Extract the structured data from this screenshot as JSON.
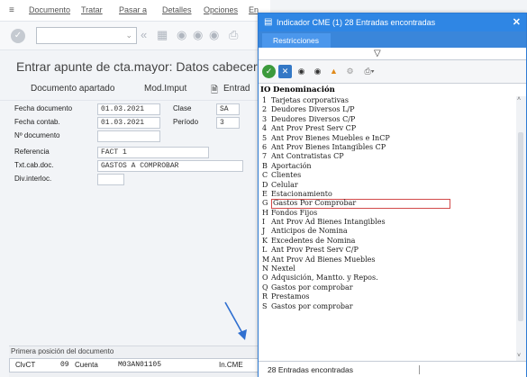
{
  "menu": {
    "items": [
      "Documento",
      "Tratar",
      "Pasar a",
      "Detalles",
      "Opciones",
      "En"
    ]
  },
  "window": {
    "title": "Entrar apunte de cta.mayor: Datos cabecera",
    "app_toolbar": [
      "Documento apartado",
      "Mod.Imput",
      "Entrad"
    ]
  },
  "form": {
    "fecha_documento_label": "Fecha documento",
    "fecha_documento": "01.03.2021",
    "clase_label": "Clase",
    "clase": "SA",
    "fecha_contab_label": "Fecha contab.",
    "fecha_contab": "01.03.2021",
    "periodo_label": "Período",
    "periodo": "3",
    "n_documento_label": "Nº documento",
    "referencia_label": "Referencia",
    "referencia": "FACT 1",
    "txt_cab_label": "Txt.cab.doc.",
    "txt_cab": "GASTOS A COMPROBAR",
    "div_interloc_label": "Div.interloc."
  },
  "bottom": {
    "title": "Primera posición del documento",
    "clvct_label": "ClvCT",
    "clvct": "09",
    "cuenta_label": "Cuenta",
    "cuenta": "M03AN01105",
    "incme_label": "In.CME"
  },
  "popup": {
    "title": "Indicador CME (1)   28 Entradas encontradas",
    "tab": "Restricciones",
    "header_io": "IO",
    "header_den": "Denominación",
    "status": "28 Entradas encontradas",
    "entries": [
      {
        "io": "1",
        "den": "Tarjetas corporativas"
      },
      {
        "io": "2",
        "den": "Deudores Diversos L/P"
      },
      {
        "io": "3",
        "den": "Deudores Diversos C/P"
      },
      {
        "io": "4",
        "den": "Ant Prov Prest Serv CP"
      },
      {
        "io": "5",
        "den": "Ant Prov Bienes Muebles e InCP"
      },
      {
        "io": "6",
        "den": "Ant Prov Bienes Intangibles CP"
      },
      {
        "io": "7",
        "den": "Ant Contratistas CP"
      },
      {
        "io": "B",
        "den": "Aportación"
      },
      {
        "io": "C",
        "den": "Clientes"
      },
      {
        "io": "D",
        "den": "Celular"
      },
      {
        "io": "E",
        "den": "Estacionamiento"
      },
      {
        "io": "G",
        "den": "Gastos Por Comprobar"
      },
      {
        "io": "H",
        "den": "Fondos Fijos"
      },
      {
        "io": "I",
        "den": "Ant Prov Ad Bienes Intangibles"
      },
      {
        "io": "J",
        "den": "Anticipos de Nomina"
      },
      {
        "io": "K",
        "den": "Excedentes de Nomina"
      },
      {
        "io": "L",
        "den": "Ant Prov Prest Serv C/P"
      },
      {
        "io": "M",
        "den": "Ant Prov Ad Bienes Muebles"
      },
      {
        "io": "N",
        "den": "Nextel"
      },
      {
        "io": "O",
        "den": "Adqusición, Mantto. y Repos."
      },
      {
        "io": "Q",
        "den": "Gastos por comprobar"
      },
      {
        "io": "R",
        "den": "Prestamos"
      },
      {
        "io": "S",
        "den": "Gastos por comprobar"
      }
    ]
  },
  "colors": {
    "titlebar": "#2f86e4",
    "tabbar": "#3a86da",
    "selection_border": "#d24a4a",
    "annotation_arrow": "#2f6fd0"
  }
}
